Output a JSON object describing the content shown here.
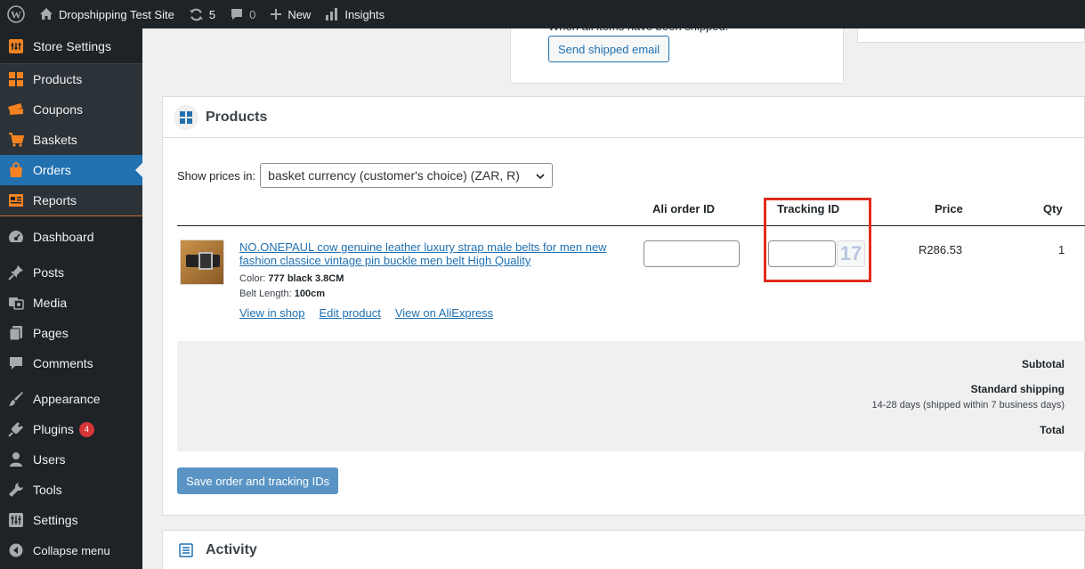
{
  "admin_bar": {
    "site_name": "Dropshipping Test Site",
    "updates_count": "5",
    "comments_count": "0",
    "new_label": "New",
    "insights_label": "Insights"
  },
  "sidebar": {
    "store_items": [
      {
        "label": "Store Settings",
        "icon": "store-settings-icon"
      },
      {
        "label": "Products",
        "icon": "products-grid-icon"
      },
      {
        "label": "Coupons",
        "icon": "coupons-icon"
      },
      {
        "label": "Baskets",
        "icon": "basket-icon"
      },
      {
        "label": "Orders",
        "icon": "orders-bag-icon",
        "active": true
      },
      {
        "label": "Reports",
        "icon": "reports-icon"
      }
    ],
    "wp_items": [
      {
        "label": "Dashboard",
        "icon": "dashboard-icon"
      },
      {
        "label": "Posts",
        "icon": "pin-icon"
      },
      {
        "label": "Media",
        "icon": "media-icon"
      },
      {
        "label": "Pages",
        "icon": "pages-icon"
      },
      {
        "label": "Comments",
        "icon": "comment-icon"
      },
      {
        "label": "Appearance",
        "icon": "brush-icon"
      },
      {
        "label": "Plugins",
        "icon": "plugin-icon",
        "badge": "4"
      },
      {
        "label": "Users",
        "icon": "user-icon"
      },
      {
        "label": "Tools",
        "icon": "wrench-icon"
      },
      {
        "label": "Settings",
        "icon": "settings-sliders-icon"
      }
    ],
    "collapse_label": "Collapse menu",
    "accent_color": "#f58220",
    "active_color": "#2271b1"
  },
  "top_card": {
    "cut_text": "When all items have been shipped:",
    "send_email_label": "Send shipped email"
  },
  "products_card": {
    "title": "Products",
    "show_prices_label": "Show prices in:",
    "currency_select_value": "basket currency (customer's choice) (ZAR, R)",
    "columns": {
      "ali_order_id": "Ali order ID",
      "tracking_id": "Tracking ID",
      "price": "Price",
      "qty": "Qty"
    },
    "item": {
      "title": "NO.ONEPAUL cow genuine leather luxury strap male belts for men new fashion classice vintage pin buckle men belt High Quality",
      "color_label": "Color:",
      "color_value": "777 black 3.8CM",
      "length_label": "Belt Length:",
      "length_value": "100cm",
      "links": [
        "View in shop",
        "Edit product",
        "View on AliExpress"
      ],
      "ali_order_id_value": "",
      "tracking_id_value": "",
      "tracking_service_logo": "17",
      "price": "R286.53",
      "qty": "1"
    },
    "totals": {
      "subtotal_label": "Subtotal",
      "shipping_label": "Standard shipping",
      "shipping_note": "14-28 days (shipped within 7 business days)",
      "total_label": "Total"
    },
    "save_button_label": "Save order and tracking IDs",
    "highlight_color": "#e02b1d"
  },
  "activity_card": {
    "title": "Activity"
  }
}
